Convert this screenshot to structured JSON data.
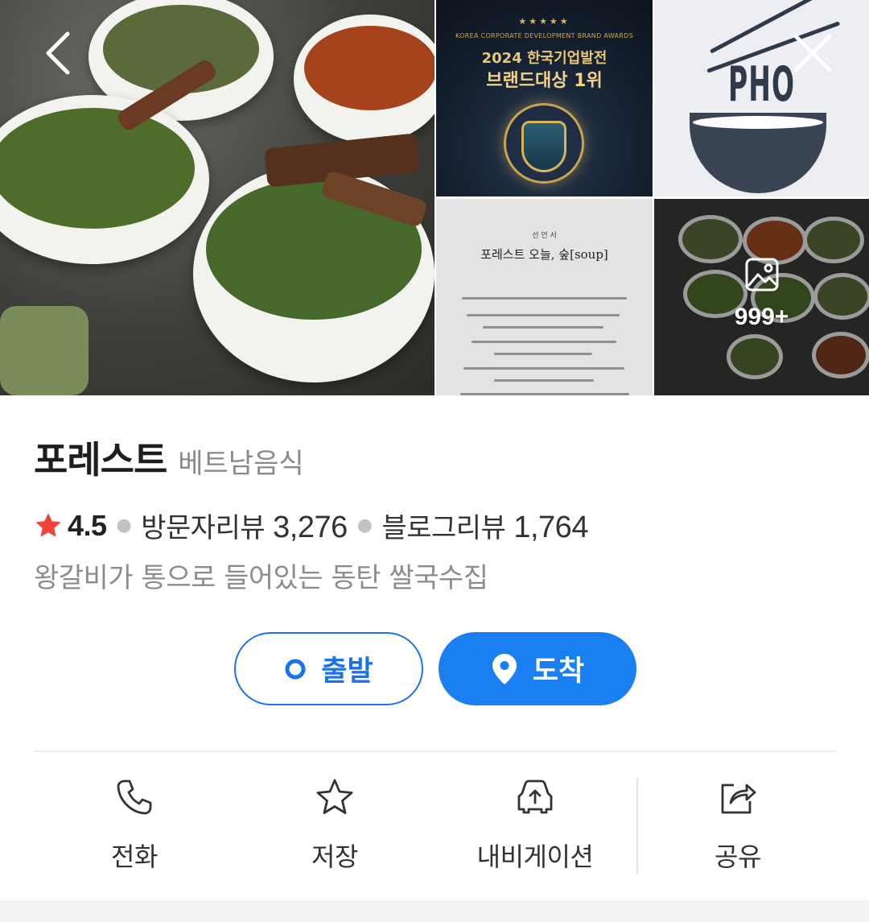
{
  "gallery": {
    "award": {
      "stars": "★★★★★",
      "subtitle": "KOREA CORPORATE DEVELOPMENT BRAND AWARDS",
      "line1": "2024 한국기업발전",
      "line2": "브랜드대상 1위"
    },
    "logo_text": "PHO",
    "document": {
      "heading_small": "선 언 서",
      "heading": "포레스트 오늘, 숲[soup]"
    },
    "more_count": "999+"
  },
  "place": {
    "name": "포레스트",
    "category": "베트남음식",
    "rating": "4.5",
    "visitor_review_label": "방문자리뷰",
    "visitor_review_count": "3,276",
    "blog_review_label": "블로그리뷰",
    "blog_review_count": "1,764",
    "description": "왕갈비가 통으로 들어있는 동탄 쌀국수집"
  },
  "route": {
    "depart_label": "출발",
    "arrive_label": "도착"
  },
  "actions": {
    "call": "전화",
    "save": "저장",
    "navigation": "내비게이션",
    "share": "공유"
  },
  "colors": {
    "accent": "#1a7ff0",
    "star": "#f0443a"
  }
}
